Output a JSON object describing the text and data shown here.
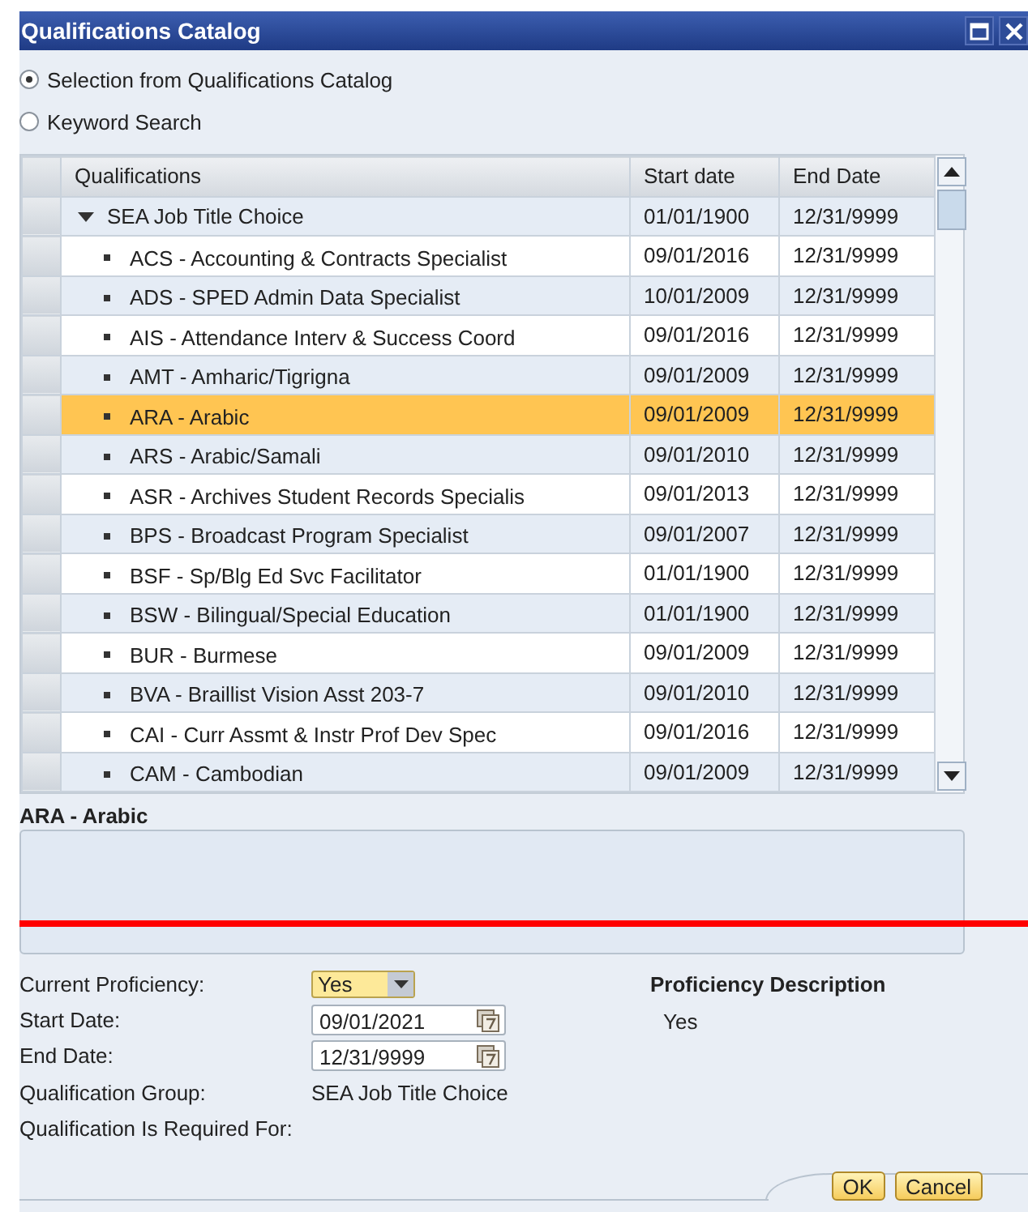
{
  "window": {
    "title": "Qualifications Catalog"
  },
  "modes": [
    {
      "label": "Selection from Qualifications Catalog",
      "selected": true
    },
    {
      "label": "Keyword Search",
      "selected": false
    }
  ],
  "table": {
    "columns": [
      "Qualifications",
      "Start date",
      "End Date"
    ],
    "rows": [
      {
        "name": "SEA Job Title Choice",
        "start": "01/01/1900",
        "end": "12/31/9999",
        "expanded": true,
        "selected": false,
        "children": [
          {
            "name": "ACS - Accounting & Contracts Specialist",
            "start": "09/01/2016",
            "end": "12/31/9999",
            "selected": false
          },
          {
            "name": "ADS - SPED Admin Data Specialist",
            "start": "10/01/2009",
            "end": "12/31/9999",
            "selected": false
          },
          {
            "name": "AIS - Attendance Interv & Success Coord",
            "start": "09/01/2016",
            "end": "12/31/9999",
            "selected": false
          },
          {
            "name": "AMT - Amharic/Tigrigna",
            "start": "09/01/2009",
            "end": "12/31/9999",
            "selected": false
          },
          {
            "name": "ARA - Arabic",
            "start": "09/01/2009",
            "end": "12/31/9999",
            "selected": true
          },
          {
            "name": "ARS - Arabic/Samali",
            "start": "09/01/2010",
            "end": "12/31/9999",
            "selected": false
          },
          {
            "name": "ASR - Archives Student Records Specialis",
            "start": "09/01/2013",
            "end": "12/31/9999",
            "selected": false
          },
          {
            "name": "BPS - Broadcast Program Specialist",
            "start": "09/01/2007",
            "end": "12/31/9999",
            "selected": false
          },
          {
            "name": "BSF - Sp/Blg Ed Svc Facilitator",
            "start": "01/01/1900",
            "end": "12/31/9999",
            "selected": false
          },
          {
            "name": "BSW - Bilingual/Special Education",
            "start": "01/01/1900",
            "end": "12/31/9999",
            "selected": false
          },
          {
            "name": "BUR - Burmese",
            "start": "09/01/2009",
            "end": "12/31/9999",
            "selected": false
          },
          {
            "name": "BVA - Braillist Vision Asst 203-7",
            "start": "09/01/2010",
            "end": "12/31/9999",
            "selected": false
          },
          {
            "name": "CAI - Curr Assmt & Instr Prof Dev Spec",
            "start": "09/01/2016",
            "end": "12/31/9999",
            "selected": false
          },
          {
            "name": "CAM - Cambodian",
            "start": "09/01/2009",
            "end": "12/31/9999",
            "selected": false
          }
        ]
      }
    ]
  },
  "detail": {
    "title": "ARA - Arabic"
  },
  "form": {
    "fields": [
      {
        "label": "Current Proficiency:",
        "kind": "dropdown",
        "value": "Yes"
      },
      {
        "label": "Start Date:",
        "kind": "date",
        "value": "09/01/2021"
      },
      {
        "label": "End Date:",
        "kind": "date",
        "value": "12/31/9999"
      },
      {
        "label": "Qualification Group:",
        "kind": "text",
        "value": "SEA Job Title Choice"
      },
      {
        "label": "Qualification Is Required For:",
        "kind": "text"
      }
    ],
    "description_title": "Proficiency Description",
    "description": "Yes"
  },
  "buttons": [
    "OK",
    "Cancel"
  ]
}
